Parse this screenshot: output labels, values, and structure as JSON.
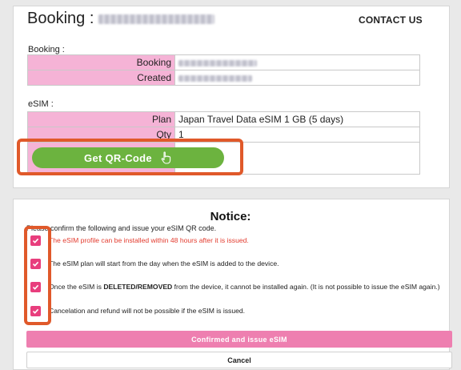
{
  "booking_panel": {
    "title": "Booking :",
    "contact_label": "CONTACT US",
    "booking_section_label": "Booking :",
    "booking_rows": [
      {
        "label": "Booking"
      },
      {
        "label": "Created"
      }
    ],
    "esim_section_label": "eSIM :",
    "esim_rows": [
      {
        "label": "Plan",
        "value": "Japan Travel Data eSIM 1 GB (5 days)"
      },
      {
        "label": "Qty",
        "value": "1"
      }
    ],
    "qr_button_label": "Get QR-Code",
    "qr_button_icon": "pointer-hand-icon"
  },
  "notice_panel": {
    "title": "Notice:",
    "subtitle": "Please confirm the following and issue your eSIM QR code.",
    "items": [
      {
        "text": "The eSIM profile can be installed within 48 hours after it is issued.",
        "checked": true,
        "highlight": true
      },
      {
        "text": "The eSIM plan will start from the day when the eSIM is added to the device.",
        "checked": true
      },
      {
        "text_before": "Once the eSIM is ",
        "text_bold": "DELETED/REMOVED",
        "text_after": " from the device, it cannot be installed again. (It is not possible to issue the eSIM again.)",
        "checked": true
      },
      {
        "text": "Cancelation and refund will not be possible if the eSIM is issued.",
        "checked": true
      }
    ],
    "confirm_button_label": "Confirmed and issue eSIM",
    "cancel_button_label": "Cancel"
  },
  "colors": {
    "label_cell_bg": "#f5b3d6",
    "qr_button_bg": "#6cb33f",
    "highlight_border": "#e0592a",
    "checkbox_bg": "#e83e7d",
    "confirm_button_bg": "#ee7fb0",
    "warning_text": "#e33b2e"
  }
}
